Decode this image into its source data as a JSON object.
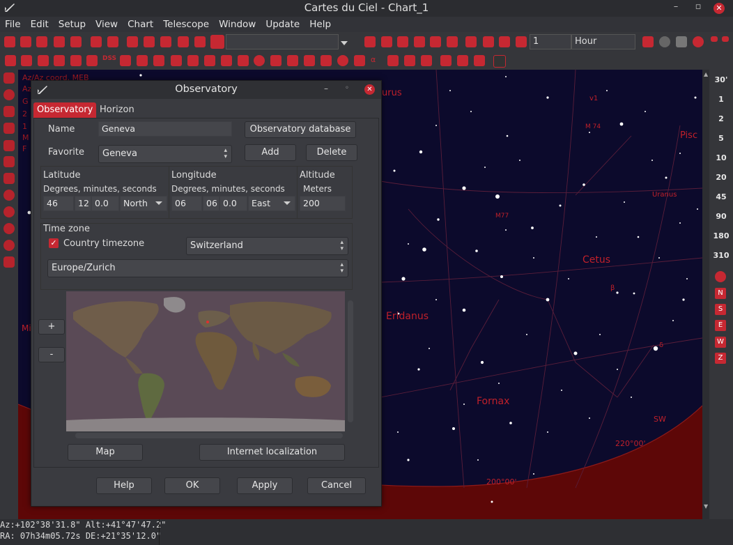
{
  "window": {
    "title": "Cartes du Ciel - Chart_1"
  },
  "menu": [
    "File",
    "Edit",
    "Setup",
    "View",
    "Chart",
    "Telescope",
    "Window",
    "Update",
    "Help"
  ],
  "toolbar": {
    "time_step_value": "1",
    "time_unit": "Hour",
    "search_value": ""
  },
  "rightbar": {
    "zoom_labels": [
      "30'",
      "1",
      "2",
      "5",
      "10",
      "20",
      "45",
      "90",
      "180",
      "310"
    ],
    "directions": [
      "N",
      "S",
      "E",
      "W",
      "Z"
    ]
  },
  "chart": {
    "overlay_lines": [
      "Az/Az coord. MEB",
      "Az",
      "G",
      "2",
      "1",
      "M",
      "F"
    ],
    "labels": {
      "aurus": "urus",
      "pisces": "Pisc",
      "uranus": "Uranus",
      "cetus": "Cetus",
      "eridanus": "Eridanus",
      "fornax": "Fornax",
      "sw": "SW",
      "az220": "220°00'",
      "az200": "200°00'",
      "m74": "M 74",
      "m77": "M77",
      "mi": "Mi",
      "v1": "v1",
      "delta": "δ",
      "beta": "β"
    }
  },
  "status": {
    "line1": "Az:+102°38'31.8\" Alt:+41°47'47.2\"",
    "line2": "RA: 07h34m05.72s DE:+21°35'12.0\""
  },
  "dialog": {
    "title": "Observatory",
    "tabs": [
      "Observatory",
      "Horizon"
    ],
    "name_label": "Name",
    "name_value": "Geneva",
    "obs_db_button": "Observatory database",
    "favorite_label": "Favorite",
    "favorite_value": "Geneva",
    "add_button": "Add",
    "delete_button": "Delete",
    "latitude": {
      "label": "Latitude",
      "sub": "Degrees, minutes, seconds",
      "deg": "46",
      "min": "12",
      "sec": "0.0",
      "hemi": "North"
    },
    "longitude": {
      "label": "Longitude",
      "sub": "Degrees, minutes, seconds",
      "deg": "06",
      "min": "06",
      "sec": "0.0",
      "hemi": "East"
    },
    "altitude": {
      "label": "Altitude",
      "sub": "Meters",
      "value": "200"
    },
    "timezone": {
      "label": "Time zone",
      "country_checkbox_label": "Country timezone",
      "country_checked": true,
      "country_value": "Switzerland",
      "zone_value": "Europe/Zurich"
    },
    "zoom_in": "+",
    "zoom_out": "-",
    "map_button": "Map",
    "internet_button": "Internet localization",
    "help_button": "Help",
    "ok_button": "OK",
    "apply_button": "Apply",
    "cancel_button": "Cancel"
  }
}
